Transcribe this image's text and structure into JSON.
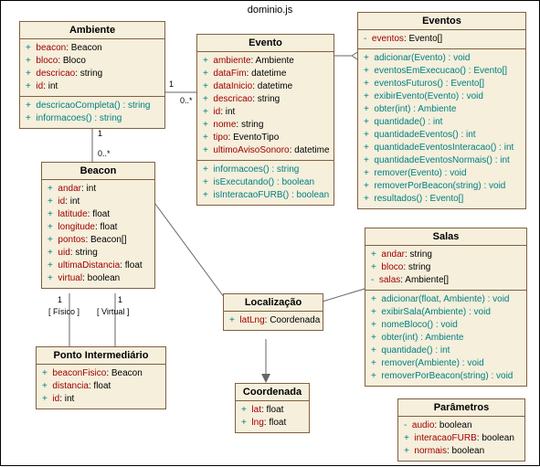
{
  "diagram_title": "dominio.js",
  "classes": {
    "Ambiente": {
      "name": "Ambiente",
      "attrs": [
        {
          "vis": "+",
          "name": "beacon",
          "type": "Beacon"
        },
        {
          "vis": "+",
          "name": "bloco",
          "type": "Bloco"
        },
        {
          "vis": "+",
          "name": "descricao",
          "type": "string"
        },
        {
          "vis": "+",
          "name": "id",
          "type": "int"
        }
      ],
      "ops": [
        {
          "vis": "+",
          "sig": "descricaoCompleta() : string"
        },
        {
          "vis": "+",
          "sig": "informacoes() : string"
        }
      ]
    },
    "Evento": {
      "name": "Evento",
      "attrs": [
        {
          "vis": "+",
          "name": "ambiente",
          "type": "Ambiente"
        },
        {
          "vis": "+",
          "name": "dataFim",
          "type": "datetime"
        },
        {
          "vis": "+",
          "name": "dataInicio",
          "type": "datetime"
        },
        {
          "vis": "+",
          "name": "descricao",
          "type": "string"
        },
        {
          "vis": "+",
          "name": "id",
          "type": "int"
        },
        {
          "vis": "+",
          "name": "nome",
          "type": "string"
        },
        {
          "vis": "+",
          "name": "tipo",
          "type": "EventoTipo"
        },
        {
          "vis": "+",
          "name": "ultimoAvisoSonoro",
          "type": "datetime"
        }
      ],
      "ops": [
        {
          "vis": "+",
          "sig": "informacoes() : string"
        },
        {
          "vis": "+",
          "sig": "isExecutando() : boolean"
        },
        {
          "vis": "+",
          "sig": "isInteracaoFURB() : boolean"
        }
      ]
    },
    "Eventos": {
      "name": "Eventos",
      "attrs": [
        {
          "vis": "-",
          "name": "eventos",
          "type": "Evento[]"
        }
      ],
      "ops": [
        {
          "vis": "+",
          "sig": "adicionar(Evento) : void"
        },
        {
          "vis": "+",
          "sig": "eventosEmExecucao() : Evento[]"
        },
        {
          "vis": "+",
          "sig": "eventosFuturos() : Evento[]"
        },
        {
          "vis": "+",
          "sig": "exibirEvento(Evento) : void"
        },
        {
          "vis": "+",
          "sig": "obter(int) : Ambiente"
        },
        {
          "vis": "+",
          "sig": "quantidade() : int"
        },
        {
          "vis": "+",
          "sig": "quantidadeEventos() : int"
        },
        {
          "vis": "+",
          "sig": "quantidadeEventosInteracao() : int"
        },
        {
          "vis": "+",
          "sig": "quantidadeEventosNormais() : int"
        },
        {
          "vis": "+",
          "sig": "remover(Evento) : void"
        },
        {
          "vis": "+",
          "sig": "removerPorBeacon(string) : void"
        },
        {
          "vis": "+",
          "sig": "resultados() : Evento[]"
        }
      ]
    },
    "Beacon": {
      "name": "Beacon",
      "attrs": [
        {
          "vis": "+",
          "name": "andar",
          "type": "int"
        },
        {
          "vis": "+",
          "name": "id",
          "type": "int"
        },
        {
          "vis": "+",
          "name": "latitude",
          "type": "float"
        },
        {
          "vis": "+",
          "name": "longitude",
          "type": "float"
        },
        {
          "vis": "+",
          "name": "pontos",
          "type": "Beacon[]"
        },
        {
          "vis": "+",
          "name": "uid",
          "type": "string"
        },
        {
          "vis": "+",
          "name": "ultimaDistancia",
          "type": "float"
        },
        {
          "vis": "+",
          "name": "virtual",
          "type": "boolean"
        }
      ]
    },
    "PontoIntermediario": {
      "name": "Ponto Intermediário",
      "attrs": [
        {
          "vis": "+",
          "name": "beaconFisico",
          "type": "Beacon"
        },
        {
          "vis": "+",
          "name": "distancia",
          "type": "float"
        },
        {
          "vis": "+",
          "name": "id",
          "type": "int"
        }
      ]
    },
    "Localizacao": {
      "name": "Localização",
      "attrs": [
        {
          "vis": "+",
          "name": "latLng",
          "type": "Coordenada"
        }
      ]
    },
    "Coordenada": {
      "name": "Coordenada",
      "attrs": [
        {
          "vis": "+",
          "name": "lat",
          "type": "float"
        },
        {
          "vis": "+",
          "name": "lng",
          "type": "float"
        }
      ]
    },
    "Salas": {
      "name": "Salas",
      "attrs": [
        {
          "vis": "+",
          "name": "andar",
          "type": "string"
        },
        {
          "vis": "+",
          "name": "bloco",
          "type": "string"
        },
        {
          "vis": "-",
          "name": "salas",
          "type": "Ambiente[]"
        }
      ],
      "ops": [
        {
          "vis": "+",
          "sig": "adicionar(float, Ambiente) : void"
        },
        {
          "vis": "+",
          "sig": "exibirSala(Ambiente) : void"
        },
        {
          "vis": "+",
          "sig": "nomeBloco() : void"
        },
        {
          "vis": "+",
          "sig": "obter(int) : Ambiente"
        },
        {
          "vis": "+",
          "sig": "quantidade() : int"
        },
        {
          "vis": "+",
          "sig": "remover(Ambiente) : void"
        },
        {
          "vis": "+",
          "sig": "removerPorBeacon(string) : void"
        }
      ]
    },
    "Parametros": {
      "name": "Parâmetros",
      "attrs": [
        {
          "vis": "-",
          "name": "audio",
          "type": "boolean"
        },
        {
          "vis": "+",
          "name": "interacaoFURB",
          "type": "boolean"
        },
        {
          "vis": "+",
          "name": "normais",
          "type": "boolean"
        }
      ]
    }
  },
  "mults": {
    "amb_evt_a": "1",
    "amb_evt_b": "0..*",
    "amb_bcn_a": "1",
    "amb_bcn_b": "0..*",
    "bcn_pi_a": "1",
    "bcn_pi_alabel": "[ Físico ]",
    "bcn_pi_b": "1",
    "bcn_pi_blabel": "[ Virtual ]"
  }
}
